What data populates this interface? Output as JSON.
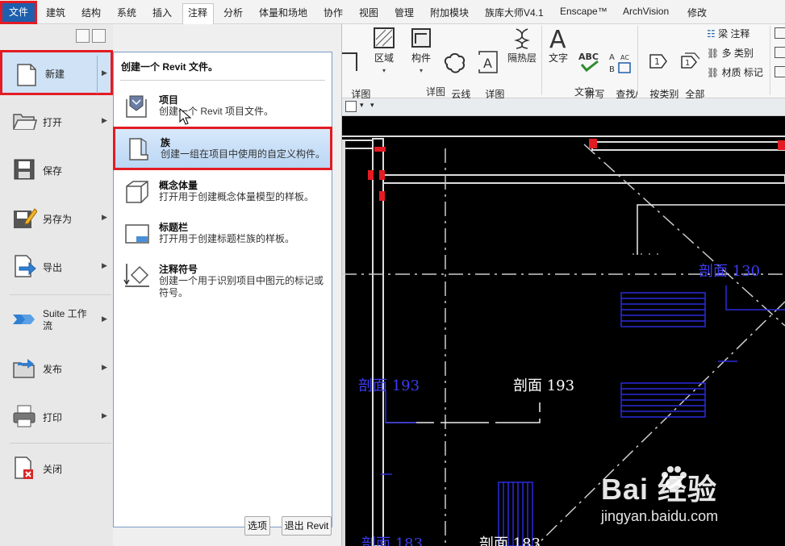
{
  "menubar": {
    "file": "文件",
    "tabs": [
      "建筑",
      "结构",
      "系统",
      "插入",
      "注释",
      "分析",
      "体量和场地",
      "协作",
      "视图",
      "管理",
      "附加模块",
      "族库大师V4.1",
      "Enscape™",
      "ArchVision",
      "修改"
    ]
  },
  "ribbon": {
    "detail_line": "详图\n线",
    "region": "区域",
    "component": "构件",
    "revision_cloud": "云线\n批注",
    "detail_group": "详图\n组",
    "insulation": "隔热层",
    "detail_group_label": "详图",
    "text": "文字",
    "spelling": "拼写\n检查",
    "find_replace": "查找/\n替换",
    "text_group_label": "文字",
    "tag_by_category": "按类别\n标记",
    "tag_all": "全部\n标记",
    "beam_annotation": "梁 注释",
    "multi_category": "多 类别",
    "material_tag": "材质 标记"
  },
  "filemenu": {
    "items": [
      {
        "label": "新建",
        "icon": "new-document-icon"
      },
      {
        "label": "打开",
        "icon": "open-folder-icon"
      },
      {
        "label": "保存",
        "icon": "save-icon"
      },
      {
        "label": "另存为",
        "icon": "save-as-icon"
      },
      {
        "label": "导出",
        "icon": "export-icon"
      },
      {
        "label": "Suite 工作流",
        "icon": "suite-workflow-icon"
      },
      {
        "label": "发布",
        "icon": "publish-icon"
      },
      {
        "label": "打印",
        "icon": "printer-icon"
      },
      {
        "label": "关闭",
        "icon": "close-document-icon"
      }
    ]
  },
  "submenu": {
    "title": "创建一个 Revit 文件。",
    "items": [
      {
        "title": "项目",
        "desc": "创建一个 Revit 项目文件。",
        "icon": "project-icon"
      },
      {
        "title": "族",
        "desc": "创建一组在项目中使用的自定义构件。",
        "icon": "family-icon"
      },
      {
        "title": "概念体量",
        "desc": "打开用于创建概念体量模型的样板。",
        "icon": "conceptual-mass-icon"
      },
      {
        "title": "标题栏",
        "desc": "打开用于创建标题栏族的样板。",
        "icon": "title-block-icon"
      },
      {
        "title": "注释符号",
        "desc": "创建一个用于识别项目中图元的标记或符号。",
        "icon": "annotation-symbol-icon"
      }
    ],
    "options_button": "选项",
    "exit_button": "退出 Revit"
  },
  "canvas": {
    "labels": [
      "剖面 130",
      "剖面 193",
      "剖面 193",
      "剖面 183",
      "剖面 183"
    ]
  },
  "watermark": {
    "brand": "Bai  经验",
    "url": "jingyan.baidu.com"
  },
  "colors": {
    "highlight_red": "#e31b23",
    "file_tab_blue": "#1e5fae",
    "cad_blue": "#2a2adc"
  }
}
